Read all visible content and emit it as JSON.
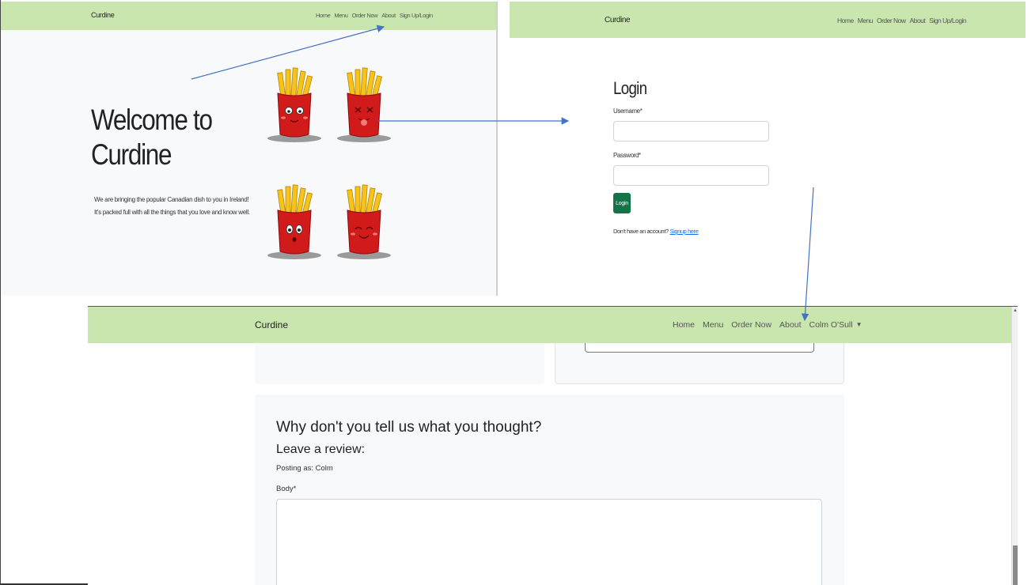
{
  "colors": {
    "navbar": "#c8e6ad",
    "page_background": "#f8f9fa",
    "login_button": "#157347",
    "link": "#0d6efd",
    "arrow": "#4472c4",
    "fries_red": "#d11a1a",
    "fries_yellow": "#f7c21a"
  },
  "home": {
    "brand": "Curdine",
    "nav": [
      "Home",
      "Menu",
      "Order Now",
      "About",
      "Sign Up/Login"
    ],
    "hero_title_line1": "Welcome to",
    "hero_title_line2": "Curdine",
    "hero_text": "We are bringing the popular Canadian dish to you in Ireland! It's packed full with all the things that you love and know well.",
    "images": [
      "fries-mascot-smiling",
      "fries-mascot-tongue",
      "fries-mascot-surprised",
      "fries-mascot-happy"
    ]
  },
  "login": {
    "brand": "Curdine",
    "nav": [
      "Home",
      "Menu",
      "Order Now",
      "About",
      "Sign Up/Login"
    ],
    "title": "Login",
    "username_label": "Username*",
    "password_label": "Password*",
    "button": "Login",
    "signup_prompt": "Don't have an account?",
    "signup_link": "Signup here"
  },
  "review": {
    "brand": "Curdine",
    "nav": [
      "Home",
      "Menu",
      "Order Now",
      "About"
    ],
    "user_menu": "Colm O'Sull",
    "heading": "Why don't you tell us what you thought?",
    "subheading": "Leave a review:",
    "posting_as": "Posting as: Colm",
    "body_label": "Body*"
  }
}
